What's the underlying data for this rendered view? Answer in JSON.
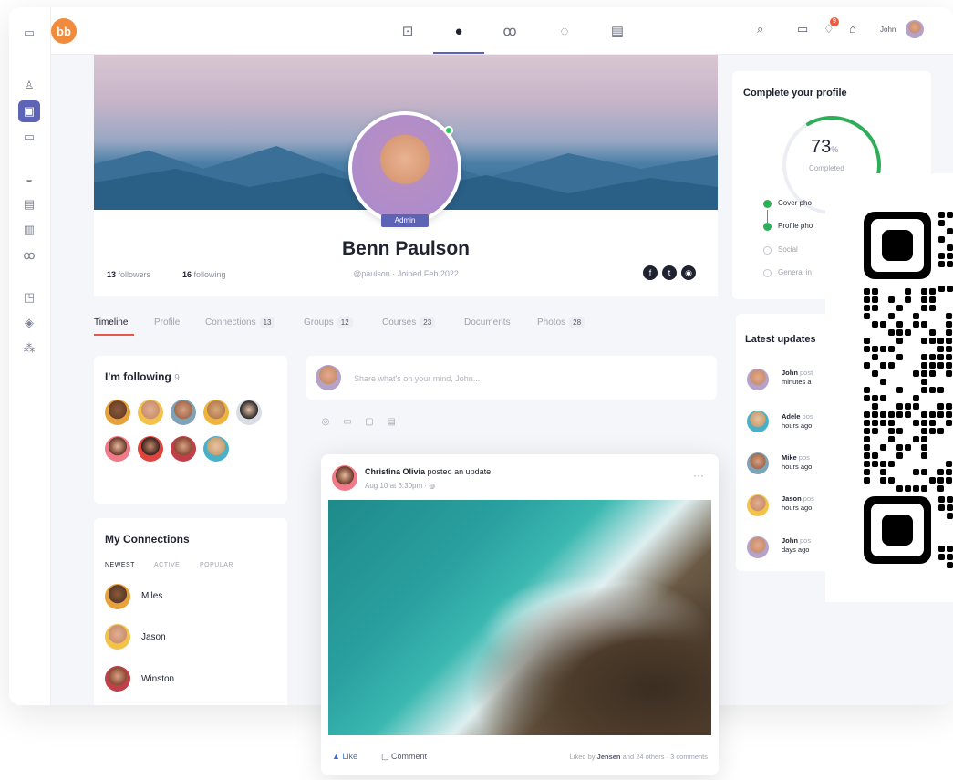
{
  "topbar": {
    "logo_text": "bb",
    "username": "John",
    "notification_count": "9"
  },
  "profile": {
    "name": "Benn Paulson",
    "badge": "Admin",
    "handle_line": "@paulson  ·  Joined Feb 2022",
    "followers_count": "13",
    "followers_label": "followers",
    "following_count": "16",
    "following_label": "following"
  },
  "tabs": [
    {
      "label": "Timeline",
      "count": ""
    },
    {
      "label": "Profile",
      "count": ""
    },
    {
      "label": "Connections",
      "count": "13"
    },
    {
      "label": "Groups",
      "count": "12"
    },
    {
      "label": "Courses",
      "count": "23"
    },
    {
      "label": "Documents",
      "count": ""
    },
    {
      "label": "Photos",
      "count": "28"
    }
  ],
  "following_card": {
    "title": "I'm following",
    "count": "9"
  },
  "connections_card": {
    "title": "My Connections",
    "subtabs": [
      "NEWEST",
      "ACTIVE",
      "POPULAR"
    ],
    "people": [
      "Miles",
      "Jason",
      "Winston"
    ]
  },
  "composer": {
    "placeholder": "Share what's on your mind, John..."
  },
  "post": {
    "author": "Christina Olivia",
    "action": "posted an update",
    "time": "Aug 10 at 6:30pm  ·",
    "like_label": "Like",
    "comment_label": "Comment",
    "liked_by_prefix": "Liked by",
    "liked_by_name": "Jensen",
    "liked_by_suffix": "and 24 others  ·  3 comments"
  },
  "complete_profile": {
    "title": "Complete your profile",
    "percent": "73",
    "percent_sign": "%",
    "progress": 0.73,
    "caption": "Completed",
    "items": [
      {
        "label": "Cover pho",
        "done": true
      },
      {
        "label": "Profile pho",
        "done": true
      },
      {
        "label": "Social",
        "done": false
      },
      {
        "label": "General in",
        "done": false
      }
    ]
  },
  "latest_updates": {
    "title": "Latest updates",
    "items": [
      {
        "name": "John",
        "verb": "post",
        "time": "minutes a"
      },
      {
        "name": "Adele",
        "verb": "pos",
        "time": "hours ago"
      },
      {
        "name": "Mike",
        "verb": "pos",
        "time": "hours ago"
      },
      {
        "name": "Jason",
        "verb": "pos",
        "time": "hours ago"
      },
      {
        "name": "John",
        "verb": "pos",
        "time": "days ago"
      }
    ]
  },
  "colors": {
    "accent": "#5d63b5",
    "progress": "#2fae5a",
    "tab_underline": "#e55a4a",
    "logo": "#f08a3c"
  }
}
